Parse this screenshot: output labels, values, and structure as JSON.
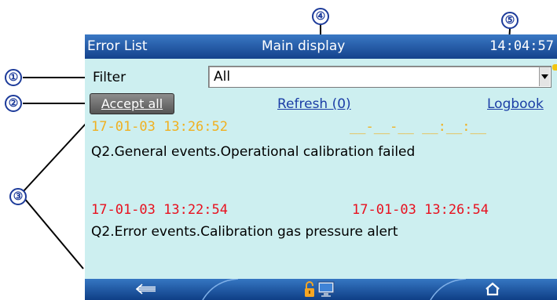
{
  "titlebar": {
    "left": "Error List",
    "center": "Main display",
    "time": "14:04:57"
  },
  "filter": {
    "label": "Filter",
    "value": "All"
  },
  "actions": {
    "accept_all": "Accept all",
    "refresh": "Refresh (0)",
    "logbook": "Logbook"
  },
  "events": [
    {
      "start": "17-01-03 13:26:52",
      "end": "__-__-__ __:__:__",
      "message": "Q2.General events.Operational calibration failed",
      "color": "#f0b020"
    },
    {
      "start": "17-01-03 13:22:54",
      "end": "17-01-03 13:26:54",
      "message": "Q2.Error events.Calibration gas pressure alert",
      "color": "#e8101e"
    }
  ],
  "bottombar": {
    "icons": [
      "back-arrow-icon",
      "unlock-icon",
      "monitor-icon",
      "home-icon"
    ]
  },
  "callouts": {
    "c1": "①",
    "c2": "②",
    "c3": "③",
    "c4": "④",
    "c5": "⑤"
  }
}
